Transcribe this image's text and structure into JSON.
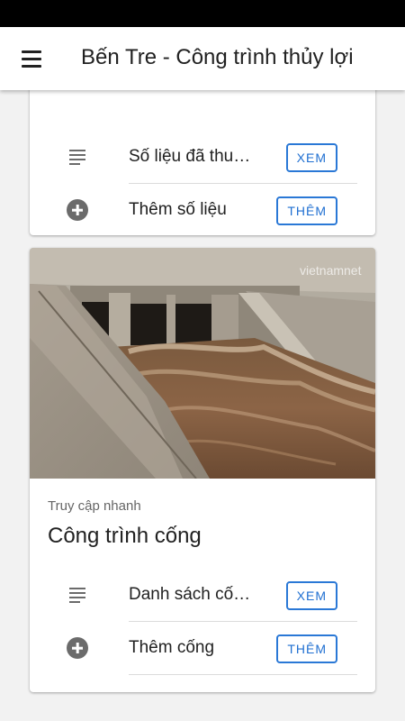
{
  "app_bar": {
    "title": "Bến Tre - Công trình thủy lợi",
    "menu_icon": "menu-icon"
  },
  "card_top": {
    "rows": [
      {
        "icon": "list-icon",
        "label": "Số liệu đã thu…",
        "button": "XEM"
      },
      {
        "icon": "add-circle-icon",
        "label": "Thêm số liệu",
        "button": "THÊM"
      }
    ]
  },
  "card_culvert": {
    "image_watermark": "vietnamnet",
    "eyebrow": "Truy cập nhanh",
    "title": "Công trình cống",
    "rows": [
      {
        "icon": "list-icon",
        "label": "Danh sách cố…",
        "button": "XEM"
      },
      {
        "icon": "add-circle-icon",
        "label": "Thêm cống",
        "button": "THÊM"
      }
    ]
  },
  "colors": {
    "accent": "#2a78d6",
    "icon_gray": "#6b6b6b",
    "background": "#f2f2f2"
  }
}
